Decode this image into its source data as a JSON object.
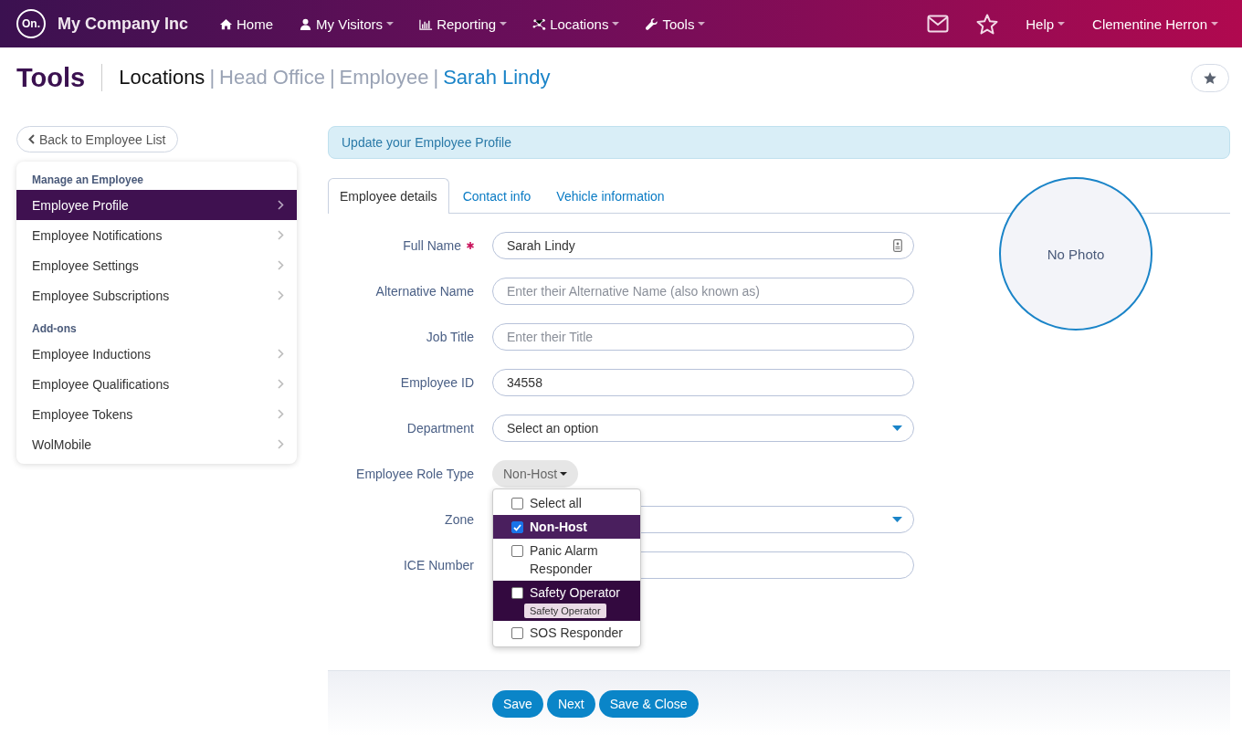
{
  "navbar": {
    "logo": "On.",
    "company": "My Company Inc",
    "menu": [
      {
        "label": "Home",
        "dropdown": false
      },
      {
        "label": "My Visitors",
        "dropdown": true
      },
      {
        "label": "Reporting",
        "dropdown": true
      },
      {
        "label": "Locations",
        "dropdown": true
      },
      {
        "label": "Tools",
        "dropdown": true
      }
    ],
    "right": [
      {
        "label": "Help",
        "dropdown": true
      },
      {
        "label": "Clementine Herron",
        "dropdown": true
      }
    ]
  },
  "header": {
    "title": "Tools",
    "breadcrumb": [
      {
        "label": "Locations",
        "kind": "current"
      },
      {
        "label": "Head Office",
        "kind": "muted",
        "separator": "|"
      },
      {
        "label": "Employee",
        "kind": "muted",
        "separator": "|"
      },
      {
        "label": "Sarah Lindy",
        "kind": "link",
        "separator": "|"
      }
    ]
  },
  "sidebar": {
    "back_button": "Back to Employee List",
    "groups": [
      {
        "heading": "Manage an Employee",
        "items": [
          {
            "label": "Employee Profile",
            "selected": true
          },
          {
            "label": "Employee Notifications",
            "selected": false
          },
          {
            "label": "Employee Settings",
            "selected": false
          },
          {
            "label": "Employee Subscriptions",
            "selected": false
          }
        ]
      },
      {
        "heading": "Add-ons",
        "items": [
          {
            "label": "Employee Inductions",
            "selected": false
          },
          {
            "label": "Employee Qualifications",
            "selected": false
          },
          {
            "label": "Employee Tokens",
            "selected": false
          },
          {
            "label": "WolMobile",
            "selected": false
          }
        ]
      }
    ]
  },
  "main": {
    "alert": "Update your Employee Profile",
    "tabs": [
      {
        "label": "Employee details",
        "selected": true
      },
      {
        "label": "Contact info",
        "selected": false
      },
      {
        "label": "Vehicle information",
        "selected": false
      }
    ],
    "photo": "No Photo",
    "fields": [
      {
        "kind": "text",
        "label": "Full Name",
        "required": true,
        "value": "Sarah Lindy"
      },
      {
        "kind": "text",
        "label": "Alternative Name",
        "required": false,
        "placeholder": "Enter their Alternative Name (also known as)"
      },
      {
        "kind": "text",
        "label": "Job Title",
        "required": false,
        "placeholder": "Enter their Title"
      },
      {
        "kind": "text",
        "label": "Employee ID",
        "required": false,
        "value": "34558"
      },
      {
        "kind": "select",
        "label": "Department",
        "required": false,
        "value": "Select an option"
      },
      {
        "kind": "multiselect",
        "label": "Employee Role Type",
        "required": false,
        "value": "Non-Host",
        "open": true,
        "options": [
          {
            "label": "Select all",
            "checked": false,
            "selected": false,
            "hovered": false
          },
          {
            "label": "Non-Host",
            "checked": true,
            "selected": true,
            "hovered": false
          },
          {
            "label": "Panic Alarm Responder",
            "checked": false,
            "selected": false,
            "hovered": false
          },
          {
            "label": "Safety Operator",
            "checked": false,
            "selected": false,
            "hovered": true,
            "tooltip": "Safety Operator"
          },
          {
            "label": "SOS Responder",
            "checked": false,
            "selected": false,
            "hovered": false
          }
        ]
      },
      {
        "kind": "select",
        "label": "Zone",
        "required": false
      },
      {
        "kind": "text",
        "label": "ICE Number",
        "required": false
      }
    ],
    "buttons": [
      "Save",
      "Next",
      "Save & Close"
    ]
  }
}
